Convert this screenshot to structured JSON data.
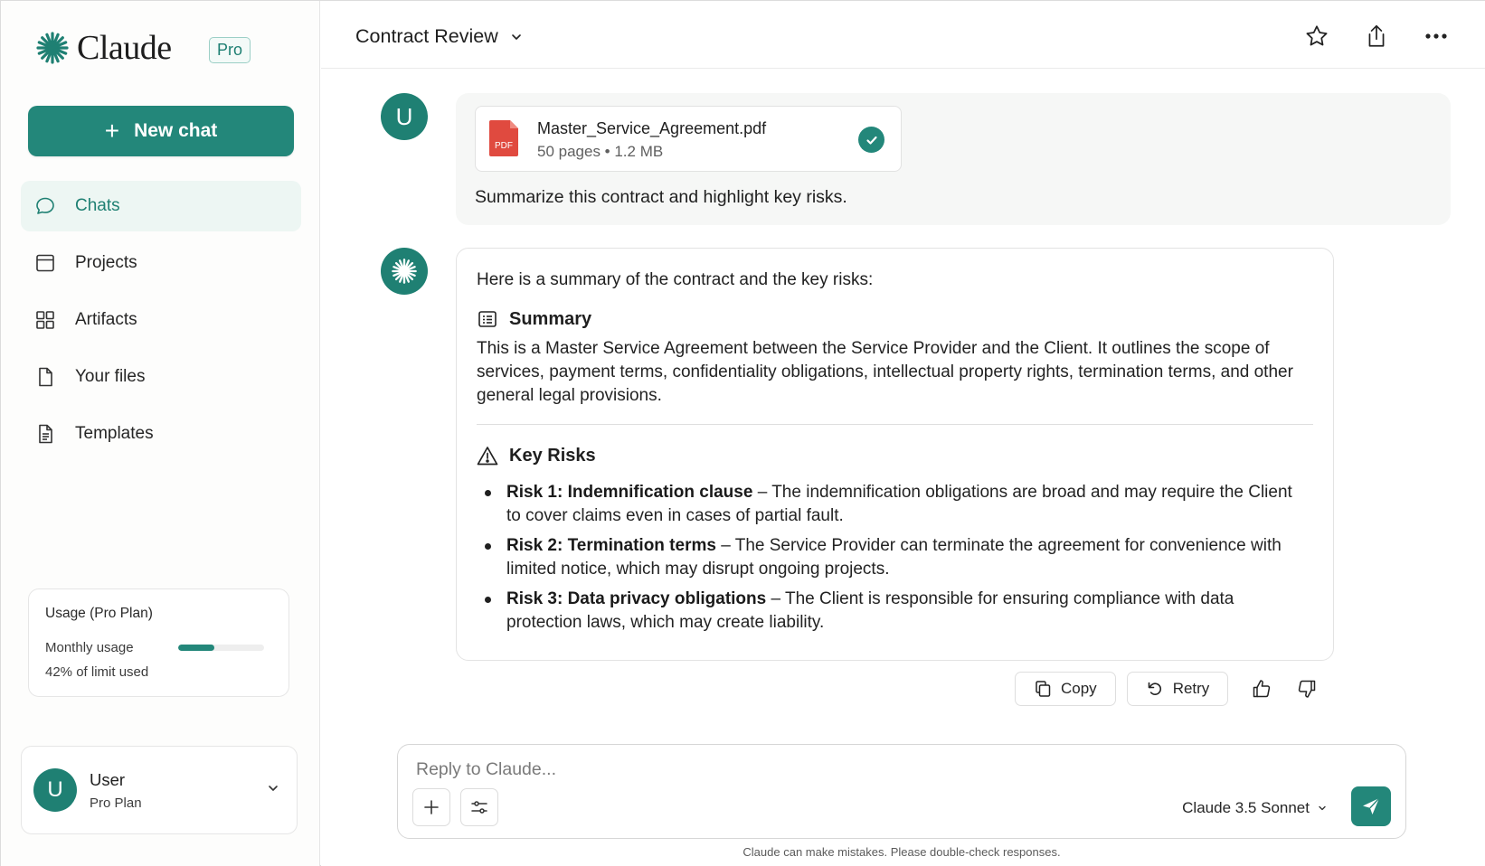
{
  "brand": {
    "name": "Claude",
    "badge": "Pro"
  },
  "sidebar": {
    "new_chat_label": "New chat",
    "items": [
      {
        "label": "Chats",
        "icon": "chat-bubble-icon",
        "active": true
      },
      {
        "label": "Projects",
        "icon": "projects-icon",
        "active": false
      },
      {
        "label": "Artifacts",
        "icon": "artifacts-grid-icon",
        "active": false
      },
      {
        "label": "Your files",
        "icon": "file-icon",
        "active": false
      },
      {
        "label": "Templates",
        "icon": "template-doc-icon",
        "active": false
      }
    ],
    "usage": {
      "title": "Usage (Pro Plan)",
      "label": "Monthly usage",
      "summary": "42% of limit used",
      "fraction": 0.42
    },
    "user": {
      "initial": "U",
      "name": "User",
      "plan": "Pro Plan"
    }
  },
  "header": {
    "title": "Contract Review"
  },
  "conversation": {
    "user_message": {
      "avatar_initial": "U",
      "attachment": {
        "name": "Master_Service_Agreement.pdf",
        "meta": "50 pages • 1.2 MB",
        "type_label": "PDF"
      },
      "text": "Summarize this contract and highlight key risks."
    },
    "assistant_message": {
      "intro": "Here is a summary of the contract and the key risks:",
      "summary_heading": "Summary",
      "summary_text": "This is a Master Service Agreement between the Service Provider and the Client. It outlines the scope of services, payment terms, confidentiality obligations, intellectual property rights, termination terms, and other general legal provisions.",
      "risks_heading": "Key Risks",
      "risks": [
        {
          "title": "Risk 1: Indemnification clause",
          "text": " – The indemnification obligations are broad and may require the Client to cover claims even in cases of partial fault."
        },
        {
          "title": "Risk 2: Termination terms",
          "text": " – The Service Provider can terminate the agreement for convenience with limited notice, which may disrupt ongoing projects."
        },
        {
          "title": "Risk 3: Data privacy obligations",
          "text": " – The Client is responsible for ensuring compliance with data protection laws, which may create liability."
        }
      ]
    },
    "actions": {
      "copy_label": "Copy",
      "retry_label": "Retry"
    }
  },
  "composer": {
    "placeholder": "Reply to Claude...",
    "model": "Claude 3.5 Sonnet",
    "disclaimer": "Claude can make mistakes. Please double-check responses."
  },
  "colors": {
    "accent": "#23877a",
    "pdf_red": "#e04a3f",
    "active_bg": "#edf6f3"
  }
}
